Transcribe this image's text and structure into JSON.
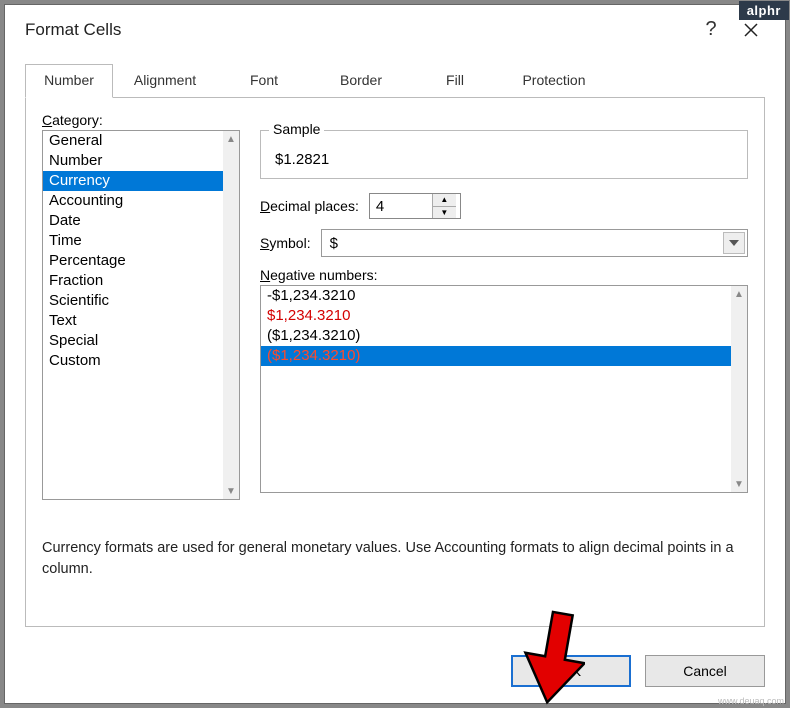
{
  "badge": "alphr",
  "window": {
    "title": "Format Cells",
    "help": "?",
    "close": "×"
  },
  "tabs": [
    "Number",
    "Alignment",
    "Font",
    "Border",
    "Fill",
    "Protection"
  ],
  "active_tab": 0,
  "category_label": "Category:",
  "categories": [
    "General",
    "Number",
    "Currency",
    "Accounting",
    "Date",
    "Time",
    "Percentage",
    "Fraction",
    "Scientific",
    "Text",
    "Special",
    "Custom"
  ],
  "category_selected": 2,
  "sample": {
    "label": "Sample",
    "value": "$1.2821"
  },
  "decimal": {
    "label": "Decimal places:",
    "value": "4"
  },
  "symbol": {
    "label": "Symbol:",
    "value": "$"
  },
  "negative": {
    "label": "Negative numbers:",
    "items": [
      {
        "text": "-$1,234.3210",
        "red": false
      },
      {
        "text": "$1,234.3210",
        "red": true
      },
      {
        "text": "($1,234.3210)",
        "red": false
      },
      {
        "text": "($1,234.3210)",
        "red": true
      }
    ],
    "selected": 3
  },
  "description": "Currency formats are used for general monetary values.  Use Accounting formats to align decimal points in a column.",
  "buttons": {
    "ok": "OK",
    "cancel": "Cancel"
  },
  "watermark": "www.deuaq.com"
}
